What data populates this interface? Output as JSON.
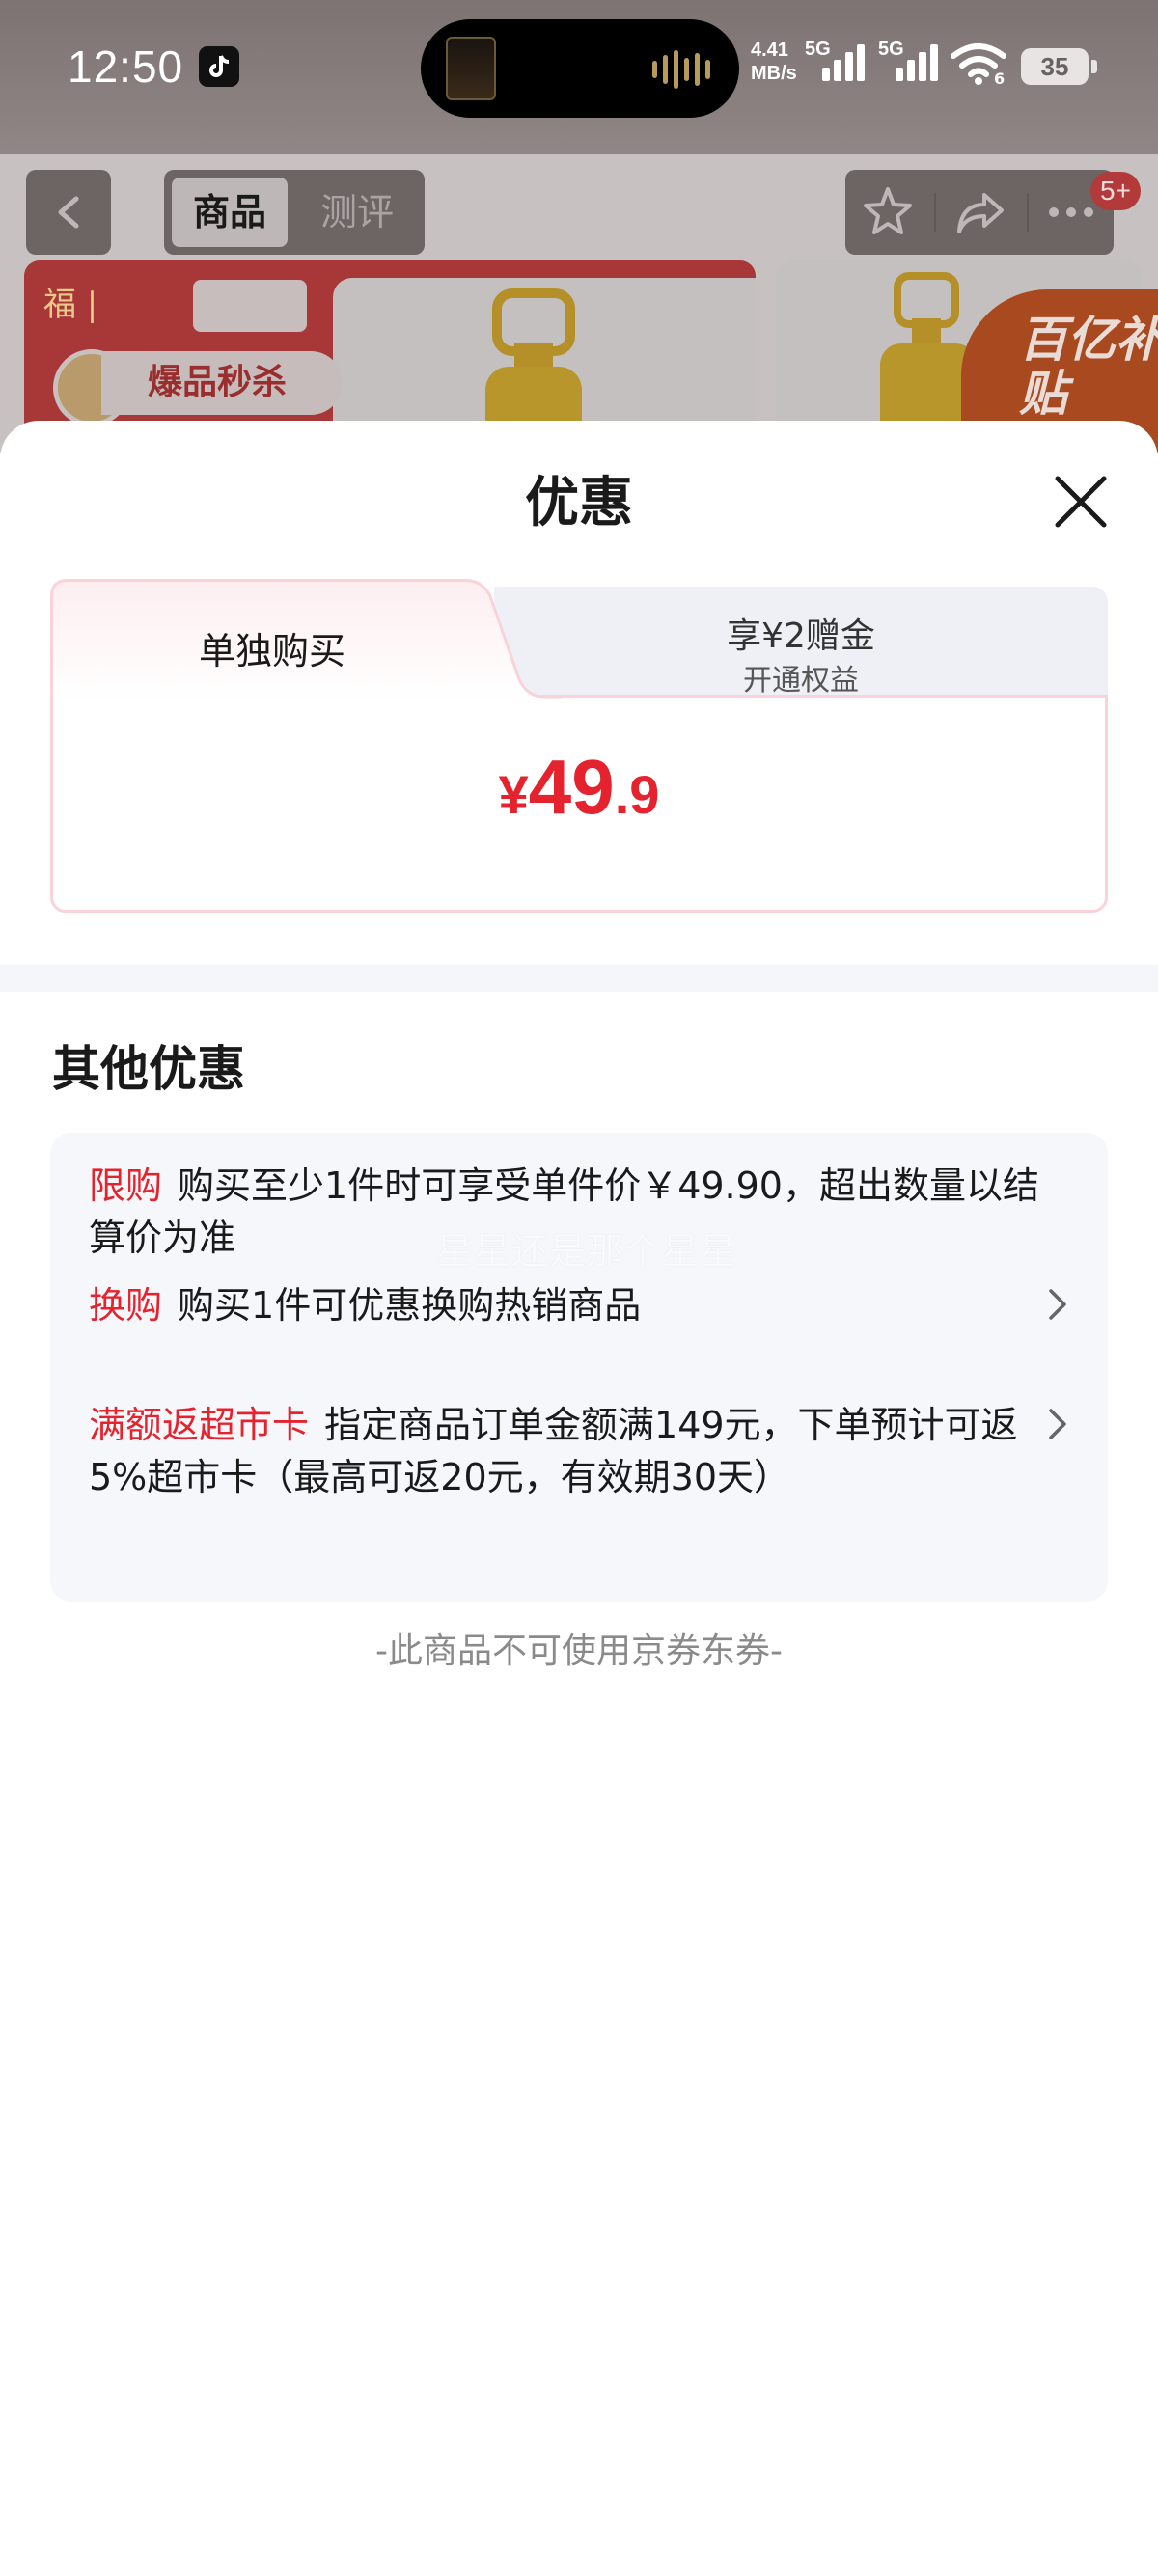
{
  "status_bar": {
    "time": "12:50",
    "net_speed_value": "4.41",
    "net_speed_unit": "MB/s",
    "sim1_label": "5G",
    "sim2_label": "5G",
    "wifi_badge": "6",
    "battery_level": "35"
  },
  "product_nav": {
    "tab_product": "商品",
    "tab_review": "测评",
    "cart_badge": "5+"
  },
  "background_banner": {
    "tag_flash_sale": "爆品秒杀",
    "subsidy_label": "百亿补贴"
  },
  "sheet": {
    "title": "优惠"
  },
  "price_card": {
    "tab_single": "单独购买",
    "tab_member_main": "享¥2赠金",
    "tab_member_sub": "开通权益",
    "price_currency": "¥",
    "price_integer": "49",
    "price_decimal": ".9"
  },
  "other_offers": {
    "title": "其他优惠",
    "watermark": "星星还是那个星星",
    "items": [
      {
        "tag": "限购",
        "text": "购买至少1件时可享受单件价￥49.90，超出数量以结算价为准",
        "has_arrow": false
      },
      {
        "tag": "换购",
        "text": "购买1件可优惠换购热销商品",
        "has_arrow": true
      },
      {
        "tag": "满额返超市卡",
        "text": "指定商品订单金额满149元，下单预计可返5%超市卡（最高可返20元，有效期30天）",
        "has_arrow": true
      }
    ],
    "footnote": "-此商品不可使用京券东券-"
  },
  "colors": {
    "accent_red": "#e5232e",
    "card_border_pink": "#fad3da",
    "offer_bg": "#f6f7fb",
    "muted_text": "#8a8a8a"
  },
  "icons": [
    "tiktok-icon",
    "back-arrow-icon",
    "star-icon",
    "share-icon",
    "more-icon",
    "close-icon",
    "chevron-right-icon",
    "wifi-icon",
    "battery-icon",
    "signal-icon"
  ]
}
